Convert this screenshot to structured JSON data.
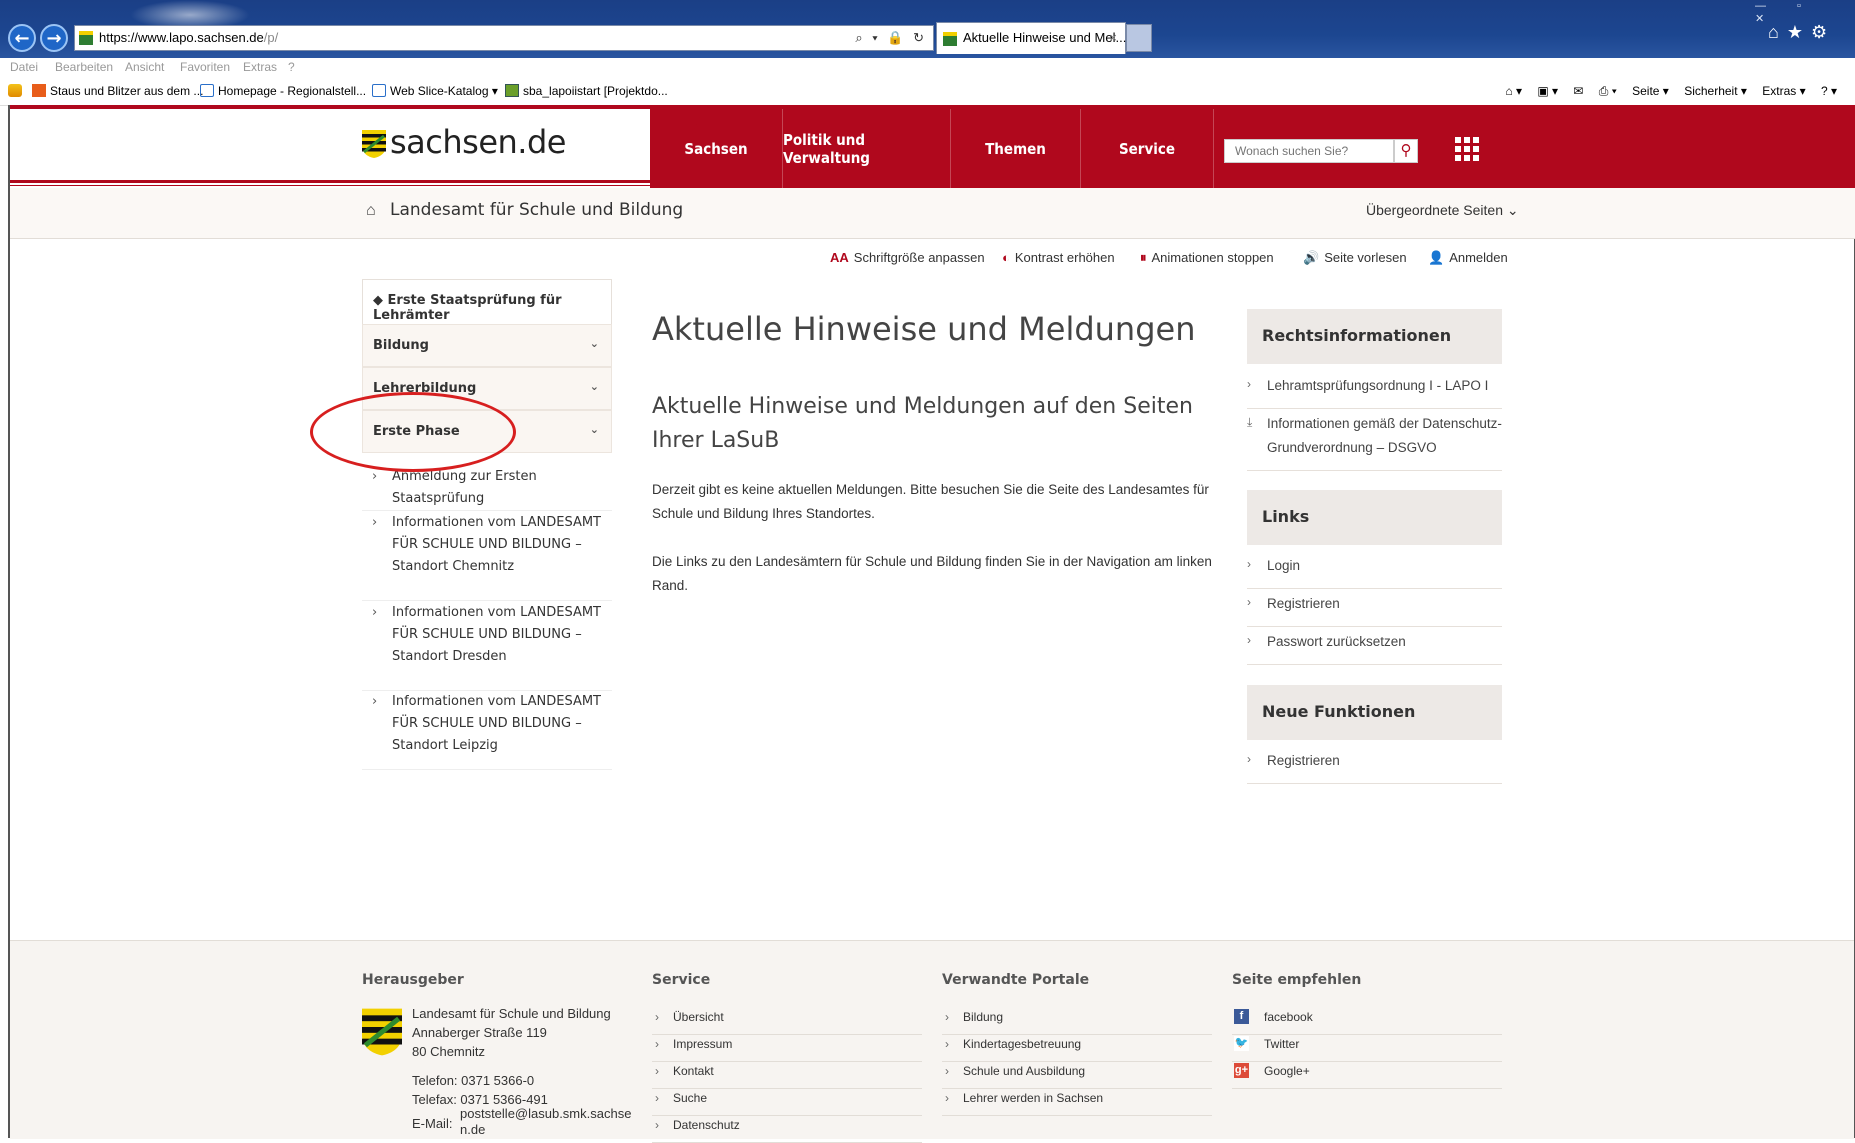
{
  "browser": {
    "url_domain": "https://www.lapo.sachsen.de",
    "url_rest": "/p/",
    "address_controls": "⌕ ▾ 🔒 ↻",
    "tab_title": "Aktuelle Hinweise und Mel...",
    "tab_close": "×",
    "menu": [
      "Datei",
      "Bearbeiten",
      "Ansicht",
      "Favoriten",
      "Extras",
      "?"
    ],
    "favorites": [
      "Staus und Blitzer aus dem ...",
      "Homepage - Regionalstell...",
      "Web Slice-Katalog ▾",
      "sba_lapoiistart [Projektdo..."
    ],
    "commands": [
      "⌂ ▾",
      "▣ ▾",
      "✉",
      "⎙ ▾",
      "Seite ▾",
      "Sicherheit ▾",
      "Extras ▾",
      "? ▾"
    ],
    "right_icons": "⌂★⚙"
  },
  "site": {
    "logo_text": "sachsen.de",
    "nav": [
      "Sachsen",
      "Politik und Verwaltung",
      "Themen",
      "Service"
    ],
    "search_placeholder": "Wonach suchen Sie?",
    "search_icon": "search-icon",
    "office": "Landesamt für Schule und Bildung",
    "parent_pages": "Übergeordnete Seiten  ⌄",
    "accessibility": [
      {
        "icon": "AA",
        "label": "Schriftgröße anpassen"
      },
      {
        "icon": "◐",
        "label": "Kontrast erhöhen"
      },
      {
        "icon": "⏸",
        "label": "Animationen stoppen"
      },
      {
        "icon": "🔊",
        "label": "Seite vorlesen"
      },
      {
        "icon": "👤",
        "label": "Anmelden"
      }
    ],
    "brand_color": "#b0081d"
  },
  "leftnav": {
    "heading": "Erste Staatsprüfung für Lehrämter",
    "items": [
      "Bildung",
      "Lehrerbildung",
      "Erste Phase"
    ],
    "subitems": [
      "Anmeldung zur Ersten Staatsprüfung",
      "Informationen vom LANDESAMT FÜR SCHULE UND BILDUNG – Standort Chemnitz",
      "Informationen vom LANDESAMT FÜR SCHULE UND BILDUNG – Standort Dresden",
      "Informationen vom LANDESAMT FÜR SCHULE UND BILDUNG – Standort Leipzig"
    ]
  },
  "main": {
    "title": "Aktuelle Hinweise und Meldungen",
    "subtitle": "Aktuelle Hinweise und Meldungen auf den Seiten Ihrer LaSuB",
    "paragraphs": [
      "Derzeit gibt es keine aktuellen Meldungen. Bitte besuchen Sie die Seite des Landesamtes für Schule und Bildung Ihres Standortes.",
      "Die Links zu den Landesämtern für Schule und Bildung finden Sie in der Navigation am linken Rand."
    ]
  },
  "sidebar": {
    "boxes": [
      {
        "title": "Rechtsinformationen",
        "links": [
          "Lehramtsprüfungsordnung I - LAPO I",
          "Informationen gemäß der Datenschutz-Grundverordnung – DSGVO"
        ]
      },
      {
        "title": "Links",
        "links": [
          "Login",
          "Registrieren",
          "Passwort zurücksetzen"
        ]
      },
      {
        "title": "Neue Funktionen",
        "links": [
          "Registrieren"
        ]
      }
    ]
  },
  "footer": {
    "publisher": {
      "heading": "Herausgeber",
      "name": "Landesamt für Schule und Bildung",
      "street": "Annaberger Straße 119",
      "city": "80 Chemnitz",
      "phone": "Telefon: 0371 5366-0",
      "fax": "Telefax: 0371 5366-491",
      "email_label": "E-Mail:",
      "email": "poststelle@lasub.smk.sachse n.de"
    },
    "service": {
      "heading": "Service",
      "links": [
        "Übersicht",
        "Impressum",
        "Kontakt",
        "Suche",
        "Datenschutz"
      ]
    },
    "portals": {
      "heading": "Verwandte Portale",
      "links": [
        "Bildung",
        "Kindertagesbetreuung",
        "Schule und Ausbildung",
        "Lehrer werden in Sachsen"
      ]
    },
    "recommend": {
      "heading": "Seite empfehlen",
      "links": [
        "facebook",
        "Twitter",
        "Google+"
      ]
    }
  }
}
